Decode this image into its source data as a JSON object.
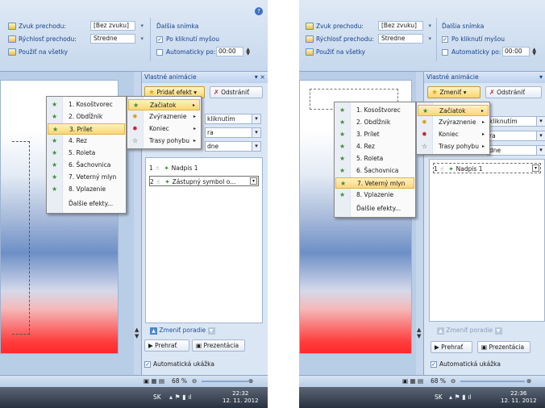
{
  "ribbon": {
    "sound_label": "Zvuk prechodu:",
    "sound_value": "[Bez zvuku]",
    "speed_label": "Rýchlosť prechodu:",
    "speed_value": "Stredne",
    "apply_all": "Použiť na všetky",
    "next_slide_title": "Ďalšia snímka",
    "on_click": "Po kliknutí myšou",
    "auto_after": "Automaticky po:",
    "auto_time": "00:00",
    "check_mark": "✓"
  },
  "panel": {
    "title": "Vlastné animácie",
    "add_effect": "Pridať efekt",
    "change": "Zmeniť",
    "remove": "Odstrániť",
    "start_tail": "kliknutím",
    "prop_tail": "ra",
    "speed_tail": "dne",
    "reorder": "Zmeniť poradie",
    "play": "Prehrať",
    "slideshow": "Prezentácia",
    "auto_preview": "Automatická ukážka"
  },
  "list_a": [
    {
      "num": "1",
      "label": "Nadpis 1"
    },
    {
      "num": "2",
      "label": "Zástupný symbol o..."
    }
  ],
  "list_b": [
    {
      "num": "1",
      "label": "Nadpis 1"
    }
  ],
  "category_menu": [
    {
      "label": "Začiatok",
      "icon": "★"
    },
    {
      "label": "Zvýraznenie",
      "icon": "✸"
    },
    {
      "label": "Koniec",
      "icon": "✹"
    },
    {
      "label": "Trasy pohybu",
      "icon": "☆"
    }
  ],
  "effects": [
    {
      "label": "1. Kosoštvorec"
    },
    {
      "label": "2. Obdĺžnik"
    },
    {
      "label": "3. Prílet"
    },
    {
      "label": "4. Rez"
    },
    {
      "label": "5. Roleta"
    },
    {
      "label": "6. Šachovnica"
    },
    {
      "label": "7. Veterný mlyn"
    },
    {
      "label": "8. Vplazenie"
    }
  ],
  "more_effects": "Ďalšie efekty...",
  "status": {
    "zoom": "68 %"
  },
  "taskbar": {
    "lang": "SK",
    "time_a": "22:32",
    "time_b": "22:36",
    "date": "12. 11. 2012"
  },
  "icons": {
    "help": "?",
    "close": "×",
    "dropdown": "▾",
    "submenu": "▸",
    "effect": "★"
  }
}
